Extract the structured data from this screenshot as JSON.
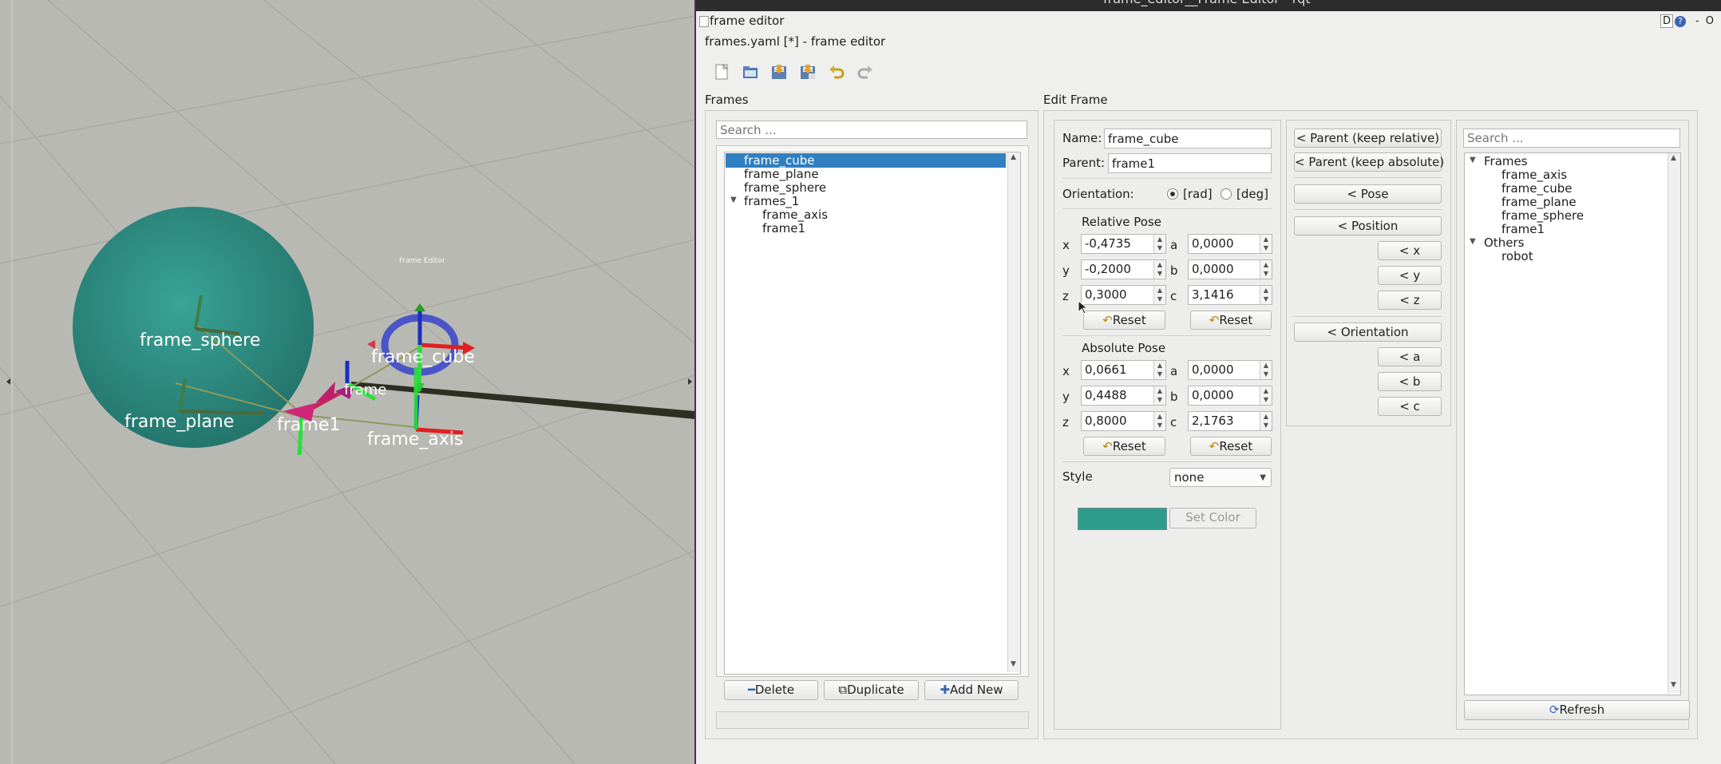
{
  "window": {
    "titlebar_text": "frame_editor__Frame Editor - rqt",
    "plugin_title": "frame editor",
    "document_title": "frames.yaml [*] - frame editor",
    "top_right_buttons": [
      "D",
      "?",
      "-",
      "O"
    ]
  },
  "toolbar": {
    "icons": [
      "new-file-icon",
      "open-file-icon",
      "save-icon",
      "save-as-icon",
      "undo-icon",
      "redo-icon"
    ]
  },
  "viewport": {
    "tooltip_text": "Frame Editor",
    "labels": {
      "frame_sphere": "frame_sphere",
      "frame_cube": "frame_cube",
      "frame_plane": "frame_plane",
      "frame1": "frame1",
      "frame_axis": "frame_axis",
      "partial": "frame"
    },
    "colors": {
      "background": "#b9b9b4",
      "sphere": "#2e8c82"
    }
  },
  "frames_panel": {
    "title": "Frames",
    "search_placeholder": "Search ...",
    "items": [
      {
        "label": "frame_cube",
        "selected": true
      },
      {
        "label": "frame_plane"
      },
      {
        "label": "frame_sphere"
      },
      {
        "label": "frames_1",
        "expanded": true
      },
      {
        "label": "frame_axis",
        "child": true
      },
      {
        "label": "frame1",
        "child": true
      }
    ],
    "delete_label": "Delete",
    "duplicate_label": "Duplicate",
    "add_new_label": "Add New"
  },
  "edit_frame": {
    "title": "Edit Frame",
    "name_label": "Name:",
    "name_value": "frame_cube",
    "parent_label": "Parent:",
    "parent_value": "frame1",
    "orientation_label": "Orientation:",
    "rad_label": "[rad]",
    "deg_label": "[deg]",
    "relative_title": "Relative Pose",
    "relative": {
      "x": "-0,4735",
      "y": "-0,2000",
      "z": "0,3000",
      "a": "0,0000",
      "b": "0,0000",
      "c": "3,1416"
    },
    "absolute_title": "Absolute Pose",
    "absolute": {
      "x": "0,0661",
      "y": "0,4488",
      "z": "0,8000",
      "a": "0,0000",
      "b": "0,0000",
      "c": "2,1763"
    },
    "axis_labels": {
      "x": "x",
      "y": "y",
      "z": "z",
      "a": "a",
      "b": "b",
      "c": "c"
    },
    "reset_label": "Reset",
    "style_label": "Style",
    "style_value": "none",
    "set_color_label": "Set Color",
    "color": "#2e9c8c"
  },
  "copy_buttons": {
    "parent_keep_relative": "< Parent (keep relative)",
    "parent_keep_absolute": "< Parent (keep absolute)",
    "pose": "< Pose",
    "position": "< Position",
    "x": "< x",
    "y": "< y",
    "z": "< z",
    "orientation": "< Orientation",
    "a": "< a",
    "b": "< b",
    "c": "< c"
  },
  "tf_panel": {
    "search_placeholder": "Search ...",
    "frames_group": "Frames",
    "frames": [
      "frame_axis",
      "frame_cube",
      "frame_plane",
      "frame_sphere",
      "frame1"
    ],
    "others_group": "Others",
    "others": [
      "robot"
    ],
    "refresh_label": "Refresh"
  }
}
